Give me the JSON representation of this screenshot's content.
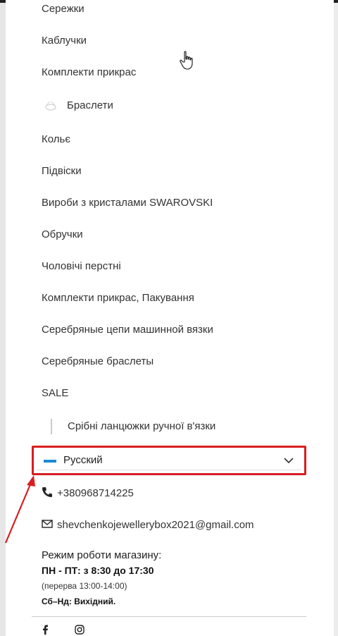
{
  "menu": {
    "items": [
      "Сережки",
      "Каблучки",
      "Комплекти прикрас",
      "Браслети",
      "Кольє",
      "Підвіски",
      "Вироби з кристалами SWAROVSKI",
      "Обручки",
      "Чоловічі перстні",
      "Комплекти прикрас, Пакування",
      "Серебряные цепи машинной вязки",
      "Серебряные браслеты",
      "SALE"
    ],
    "sub_item": "Срібні ланцюжки ручної в'язки"
  },
  "language": {
    "selected": "Русский",
    "flag_color": "#1c8ad6",
    "highlight_color": "#d81e22"
  },
  "contacts": {
    "phone": "+380968714225",
    "email": "shevchenkojewellerybox2021@gmail.com"
  },
  "hours": {
    "title": "Режим роботи магазину:",
    "weekdays": "ПН - ПТ: з 8:30 до 17:30",
    "break": "(перерва 13:00-14:00)",
    "weekend": "Сб–Нд: Вихідний."
  },
  "social": [
    "facebook-icon",
    "instagram-icon"
  ]
}
